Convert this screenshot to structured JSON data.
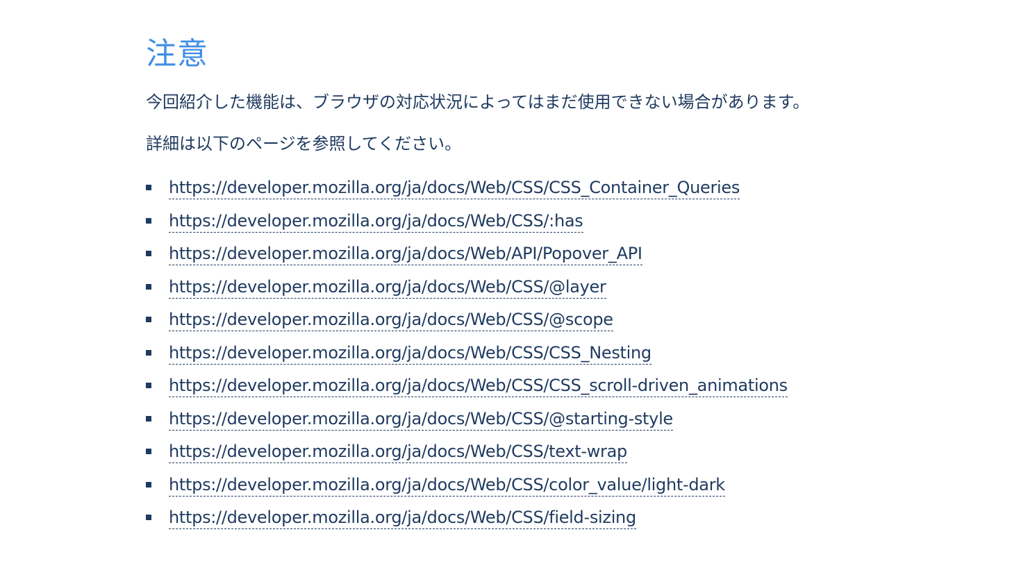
{
  "heading": "注意",
  "paragraphs": [
    "今回紹介した機能は、ブラウザの対応状況によってはまだ使用できない場合があります。",
    "詳細は以下のページを参照してください。"
  ],
  "links": [
    "https://developer.mozilla.org/ja/docs/Web/CSS/CSS_Container_Queries",
    "https://developer.mozilla.org/ja/docs/Web/CSS/:has",
    "https://developer.mozilla.org/ja/docs/Web/API/Popover_API",
    "https://developer.mozilla.org/ja/docs/Web/CSS/@layer",
    "https://developer.mozilla.org/ja/docs/Web/CSS/@scope",
    "https://developer.mozilla.org/ja/docs/Web/CSS/CSS_Nesting",
    "https://developer.mozilla.org/ja/docs/Web/CSS/CSS_scroll-driven_animations",
    "https://developer.mozilla.org/ja/docs/Web/CSS/@starting-style",
    "https://developer.mozilla.org/ja/docs/Web/CSS/text-wrap",
    "https://developer.mozilla.org/ja/docs/Web/CSS/color_value/light-dark",
    "https://developer.mozilla.org/ja/docs/Web/CSS/field-sizing"
  ],
  "colors": {
    "heading": "#3f8ee6",
    "text": "#1f3a5f"
  }
}
